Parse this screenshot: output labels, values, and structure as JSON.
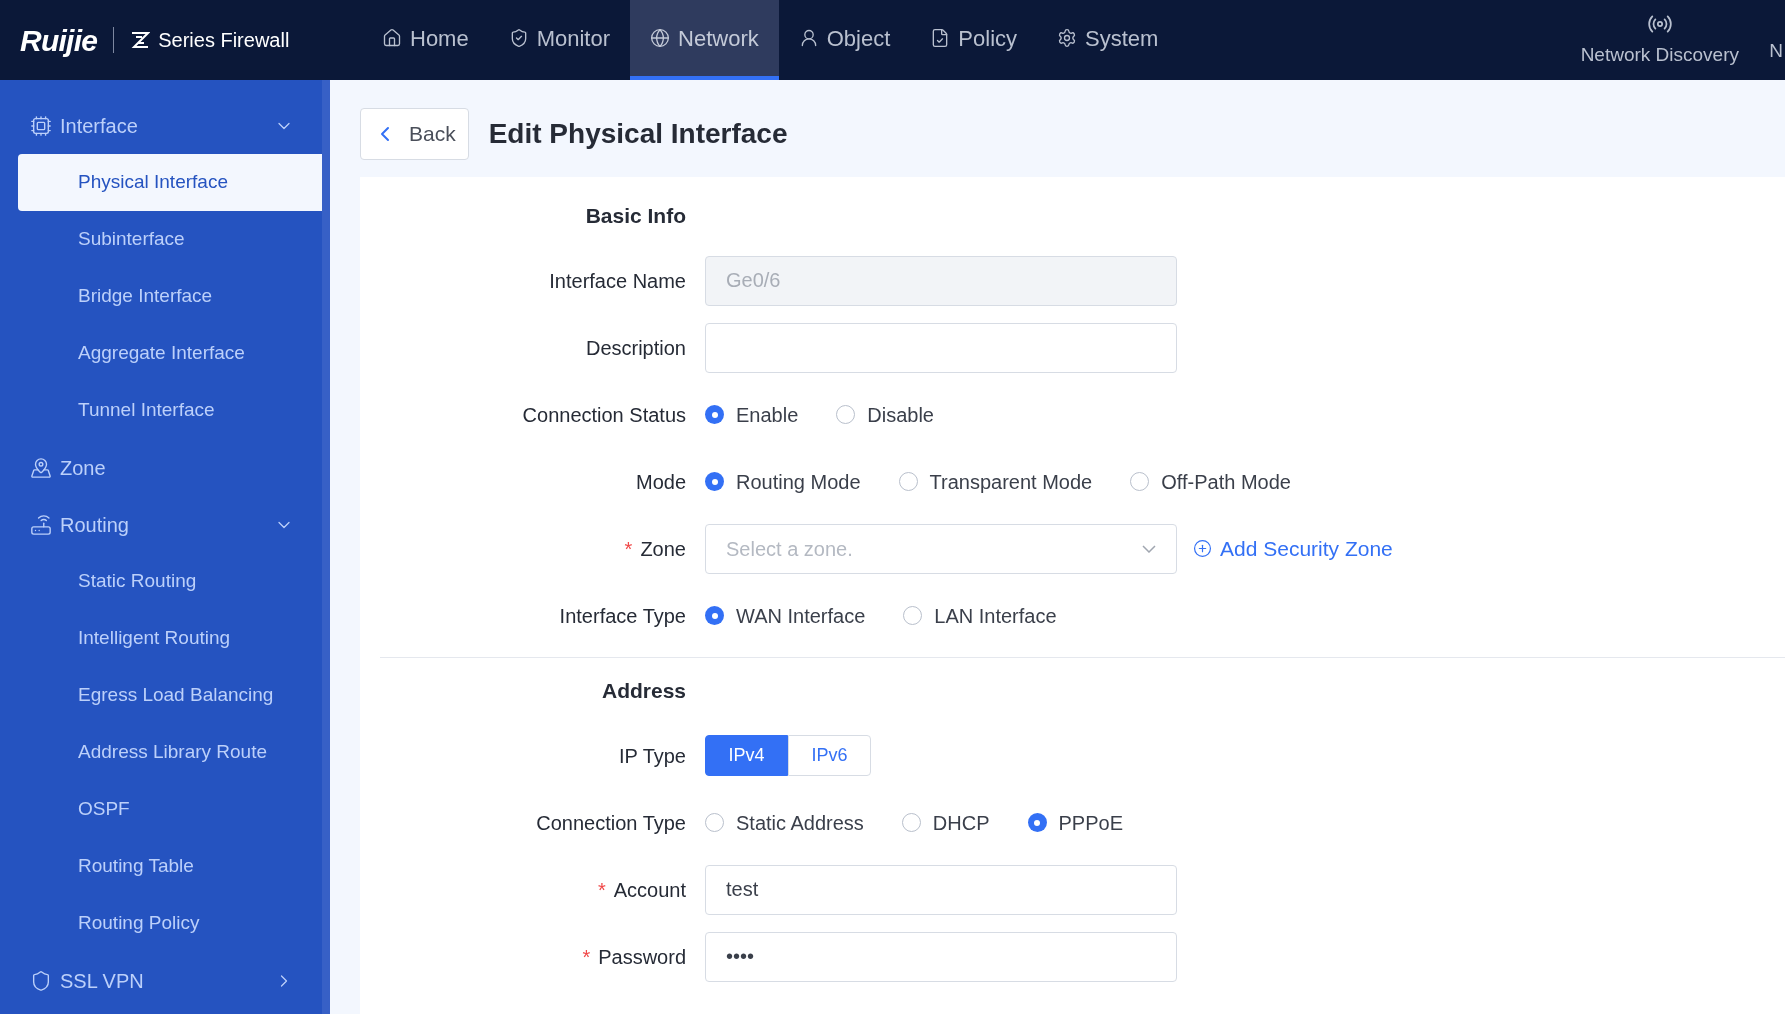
{
  "brand": {
    "logo": "Ruijie",
    "product": "Series Firewall"
  },
  "top_nav": [
    {
      "label": "Home",
      "selected": false
    },
    {
      "label": "Monitor",
      "selected": false
    },
    {
      "label": "Network",
      "selected": true
    },
    {
      "label": "Object",
      "selected": false
    },
    {
      "label": "Policy",
      "selected": false
    },
    {
      "label": "System",
      "selected": false
    }
  ],
  "top_right": [
    {
      "label": "Network Discovery"
    },
    {
      "label": "N"
    }
  ],
  "sidebar": [
    {
      "label": "Interface",
      "expanded": true,
      "children": [
        {
          "label": "Physical Interface",
          "selected": true
        },
        {
          "label": "Subinterface",
          "selected": false
        },
        {
          "label": "Bridge Interface",
          "selected": false
        },
        {
          "label": "Aggregate Interface",
          "selected": false
        },
        {
          "label": "Tunnel Interface",
          "selected": false
        }
      ]
    },
    {
      "label": "Zone"
    },
    {
      "label": "Routing",
      "expanded": true,
      "children": [
        {
          "label": "Static Routing",
          "selected": false
        },
        {
          "label": "Intelligent Routing",
          "selected": false
        },
        {
          "label": "Egress Load Balancing",
          "selected": false
        },
        {
          "label": "Address Library Route",
          "selected": false
        },
        {
          "label": "OSPF",
          "selected": false
        },
        {
          "label": "Routing Table",
          "selected": false
        },
        {
          "label": "Routing Policy",
          "selected": false
        }
      ]
    },
    {
      "label": "SSL VPN",
      "expanded": false
    }
  ],
  "page": {
    "back": "Back",
    "title": "Edit Physical Interface"
  },
  "sections": [
    {
      "title": "Basic Info",
      "fields": [
        {
          "kind": "text",
          "label": "Interface Name",
          "disabled": true,
          "value": "Ge0/6"
        },
        {
          "kind": "text",
          "label": "Description",
          "disabled": false
        },
        {
          "kind": "radio",
          "label": "Connection Status",
          "options": [
            {
              "label": "Enable",
              "selected": true
            },
            {
              "label": "Disable",
              "selected": false
            }
          ]
        },
        {
          "kind": "radio",
          "label": "Mode",
          "options": [
            {
              "label": "Routing Mode",
              "selected": true
            },
            {
              "label": "Transparent Mode",
              "selected": false
            },
            {
              "label": "Off-Path Mode",
              "selected": false
            }
          ]
        },
        {
          "kind": "select",
          "label": "Zone",
          "required_mark": "*",
          "placeholder": "Select a zone.",
          "link": "Add Security Zone"
        },
        {
          "kind": "radio",
          "label": "Interface Type",
          "options": [
            {
              "label": "WAN Interface",
              "selected": true
            },
            {
              "label": "LAN Interface",
              "selected": false
            }
          ]
        }
      ]
    },
    {
      "title": "Address",
      "fields": [
        {
          "kind": "segmented",
          "label": "IP Type",
          "options": [
            {
              "label": "IPv4",
              "selected": true
            },
            {
              "label": "IPv6",
              "selected": false
            }
          ]
        },
        {
          "kind": "radio",
          "label": "Connection Type",
          "options": [
            {
              "label": "Static Address",
              "selected": false
            },
            {
              "label": "DHCP",
              "selected": false
            },
            {
              "label": "PPPoE",
              "selected": true
            }
          ]
        },
        {
          "kind": "text",
          "label": "Account",
          "required_mark": "*",
          "disabled": false,
          "value": "test"
        },
        {
          "kind": "text",
          "label": "Password",
          "required_mark": "*",
          "disabled": false,
          "value": "••••"
        }
      ]
    }
  ]
}
